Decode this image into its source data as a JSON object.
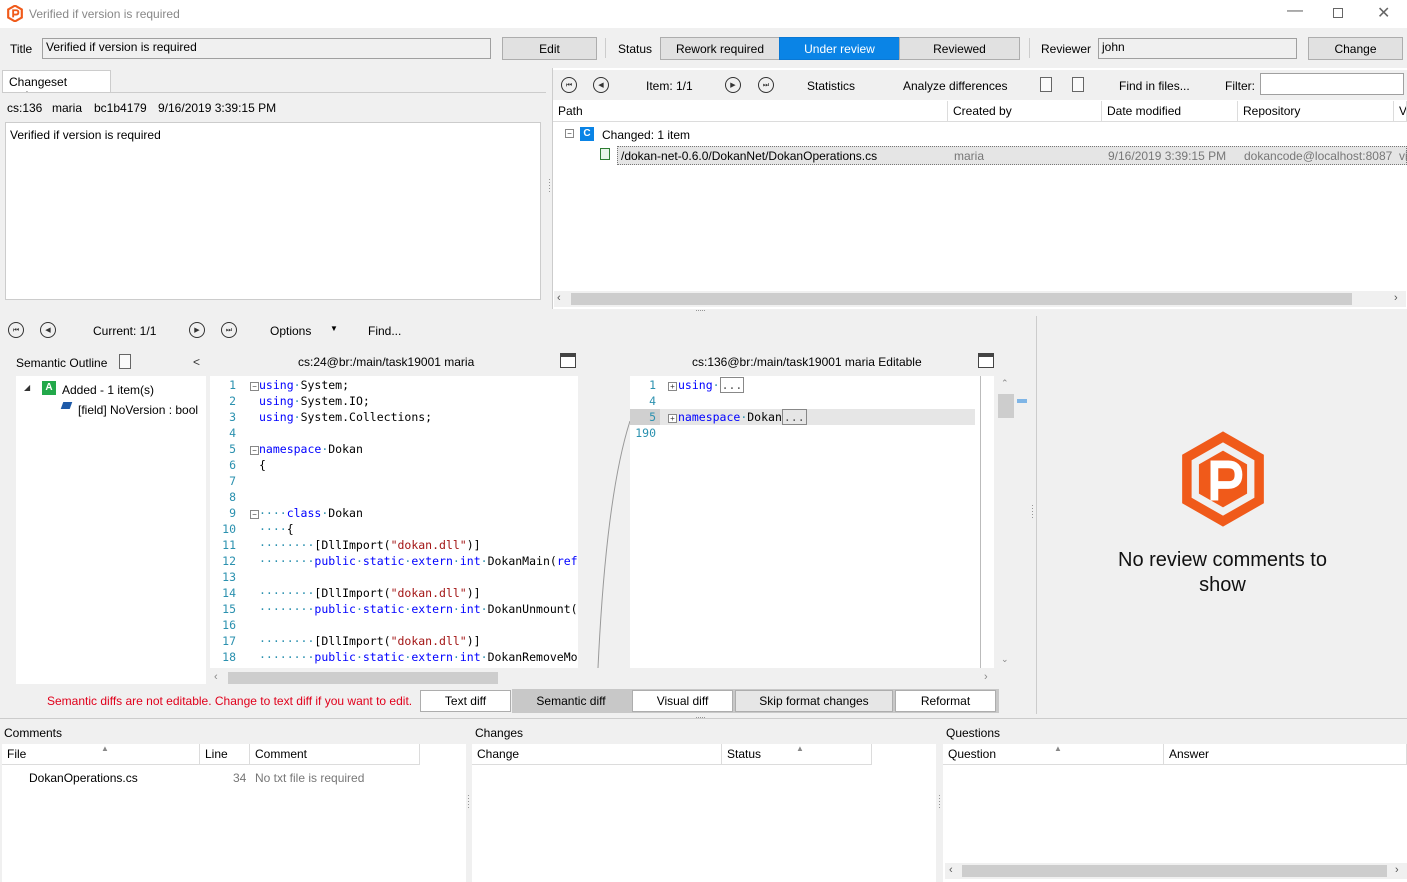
{
  "window": {
    "title": "Verified if version is required"
  },
  "toolbar": {
    "title_label": "Title",
    "title_value": "Verified if version is required",
    "edit_label": "Edit",
    "status_label": "Status",
    "status_options": [
      "Rework required",
      "Under review",
      "Reviewed"
    ],
    "status_selected": "Under review",
    "reviewer_label": "Reviewer",
    "reviewer_value": "john",
    "change_label": "Change"
  },
  "changeset": {
    "tab_label": "Changeset review",
    "cs": "cs:136",
    "user": "maria",
    "hash": "bc1b4179",
    "date": "9/16/2019 3:39:15 PM",
    "description": "Verified if version is required"
  },
  "items_pane": {
    "item_label": "Item: 1/1",
    "statistics": "Statistics",
    "analyze": "Analyze differences",
    "find_files": "Find in files...",
    "filter_label": "Filter:",
    "filter_value": "",
    "columns": [
      "Path",
      "Created by",
      "Date modified",
      "Repository",
      "V"
    ],
    "group_label": "Changed: 1 item",
    "group_badge": "C",
    "row": {
      "path": "/dokan-net-0.6.0/DokanNet/DokanOperations.cs",
      "created_by": "maria",
      "date": "9/16/2019 3:39:15 PM",
      "repository": "dokancode@localhost:8087",
      "v": "vi"
    }
  },
  "diff_toolbar": {
    "current_label": "Current: 1/1",
    "options_label": "Options",
    "find_label": "Find..."
  },
  "outline": {
    "title": "Semantic Outline",
    "collapse_glyph": "<",
    "group_badge": "A",
    "group_label": "Added - 1 item(s)",
    "item_label": "[field] NoVersion : bool"
  },
  "left_diff": {
    "header": "cs:24@br:/main/task19001 maria",
    "lines": [
      {
        "n": "1",
        "t": "using·System;"
      },
      {
        "n": "2",
        "t": "using·System.IO;"
      },
      {
        "n": "3",
        "t": "using·System.Collections;"
      },
      {
        "n": "4",
        "t": ""
      },
      {
        "n": "5",
        "t": "namespace·Dokan"
      },
      {
        "n": "6",
        "t": "{"
      },
      {
        "n": "7",
        "t": ""
      },
      {
        "n": "8",
        "t": ""
      },
      {
        "n": "9",
        "t": "····class·Dokan"
      },
      {
        "n": "10",
        "t": "····{"
      },
      {
        "n": "11",
        "t": "········[DllImport(\"dokan.dll\")]"
      },
      {
        "n": "12",
        "t": "········public·static·extern·int·DokanMain(ref"
      },
      {
        "n": "13",
        "t": ""
      },
      {
        "n": "14",
        "t": "········[DllImport(\"dokan.dll\")]"
      },
      {
        "n": "15",
        "t": "········public·static·extern·int·DokanUnmount("
      },
      {
        "n": "16",
        "t": ""
      },
      {
        "n": "17",
        "t": "········[DllImport(\"dokan.dll\")]"
      },
      {
        "n": "18",
        "t": "········public·static·extern·int·DokanRemoveMo"
      }
    ]
  },
  "right_diff": {
    "header": "cs:136@br:/main/task19001 maria Editable",
    "lines": [
      {
        "n": "1",
        "t": "using·",
        "fold": "..."
      },
      {
        "n": "4",
        "t": ""
      },
      {
        "n": "5",
        "t": "namespace·Dokan",
        "fold": "..."
      },
      {
        "n": "190",
        "t": ""
      }
    ]
  },
  "diff_footer": {
    "warning": "Semantic diffs are not editable. Change to text diff if you want to edit.",
    "buttons": [
      "Text diff",
      "Semantic diff",
      "Visual diff",
      "Skip format changes",
      "Reformat"
    ],
    "active": "Semantic diff"
  },
  "review_panel": {
    "empty_message_line1": "No review comments to",
    "empty_message_line2": "show"
  },
  "comments": {
    "title": "Comments",
    "columns": [
      "File",
      "Line",
      "Comment"
    ],
    "rows": [
      {
        "file": "DokanOperations.cs",
        "line": "34",
        "comment": "No txt file is required"
      }
    ]
  },
  "changes": {
    "title": "Changes",
    "columns": [
      "Change",
      "Status"
    ]
  },
  "questions": {
    "title": "Questions",
    "columns": [
      "Question",
      "Answer"
    ]
  },
  "colors": {
    "accent": "#0a84e6",
    "logo": "#f05a1a",
    "warning": "#e0001b",
    "keyword": "#0000ff",
    "string": "#a31515",
    "linenum": "#2b91af"
  }
}
